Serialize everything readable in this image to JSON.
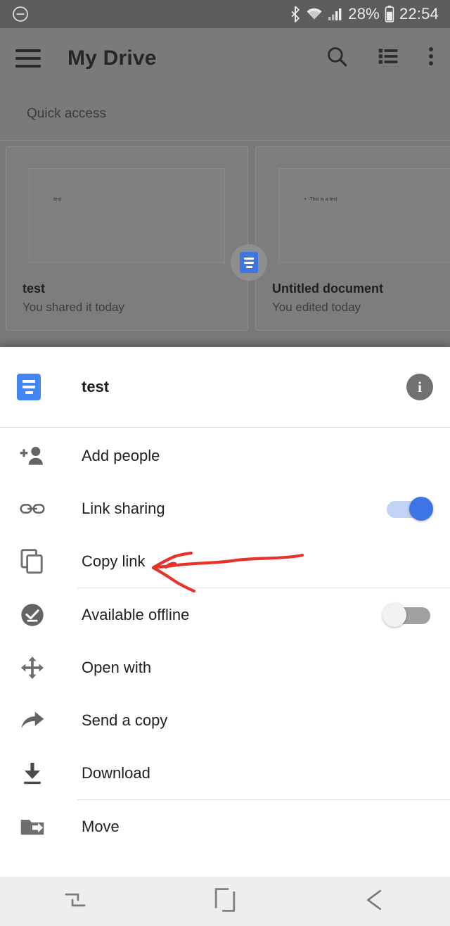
{
  "status_bar": {
    "left_icon": "minus-circle-icon",
    "icons": [
      "bluetooth-icon",
      "wifi-icon",
      "cellular-signal-icon",
      "battery-icon"
    ],
    "battery_percent": "28%",
    "time": "22:54"
  },
  "toolbar": {
    "menu_icon": "hamburger-menu-icon",
    "title": "My Drive",
    "actions": [
      {
        "name": "search-icon"
      },
      {
        "name": "list-view-icon"
      },
      {
        "name": "overflow-menu-icon"
      }
    ]
  },
  "content": {
    "section_label": "Quick access",
    "cards": [
      {
        "title": "test",
        "subtitle": "You shared it today",
        "thumb_text": "test",
        "badge_icon": "google-docs-icon"
      },
      {
        "title": "Untitled document",
        "subtitle": "You edited today",
        "thumb_text": "This is a test",
        "badge_icon": "google-docs-icon"
      }
    ]
  },
  "sheet": {
    "file_icon": "google-docs-icon",
    "file_name": "test",
    "info_icon": "info-icon",
    "info_glyph": "i",
    "items": [
      {
        "label": "Add people",
        "icon": "add-person-icon",
        "toggle": null,
        "divider_after": false
      },
      {
        "label": "Link sharing",
        "icon": "link-icon",
        "toggle": "on",
        "divider_after": false
      },
      {
        "label": "Copy link",
        "icon": "copy-icon",
        "toggle": null,
        "divider_after": true
      },
      {
        "label": "Available offline",
        "icon": "check-circle-icon",
        "toggle": "off",
        "divider_after": false
      },
      {
        "label": "Open with",
        "icon": "move-arrows-icon",
        "toggle": null,
        "divider_after": false
      },
      {
        "label": "Send a copy",
        "icon": "share-arrow-icon",
        "toggle": null,
        "divider_after": false
      },
      {
        "label": "Download",
        "icon": "download-icon",
        "toggle": null,
        "divider_after": true
      },
      {
        "label": "Move",
        "icon": "move-to-folder-icon",
        "toggle": null,
        "divider_after": false
      }
    ]
  },
  "nav_bar": {
    "buttons": [
      {
        "name": "recents-button",
        "icon": "recents-icon"
      },
      {
        "name": "home-button",
        "icon": "home-square-icon"
      },
      {
        "name": "back-button",
        "icon": "back-arrow-icon"
      }
    ]
  },
  "annotation": {
    "type": "hand-drawn-arrow",
    "color": "#e8322a",
    "points_at": "Copy link"
  },
  "colors": {
    "accent_blue": "#4285f4",
    "toggle_on_thumb": "#3f74e4",
    "toggle_on_track": "#c2d3f7",
    "toggle_off_track": "#a0a0a0",
    "annotation_red": "#e8322a",
    "status_bar_bg": "#5d5d5d",
    "scrim": "#7a7a7a"
  }
}
